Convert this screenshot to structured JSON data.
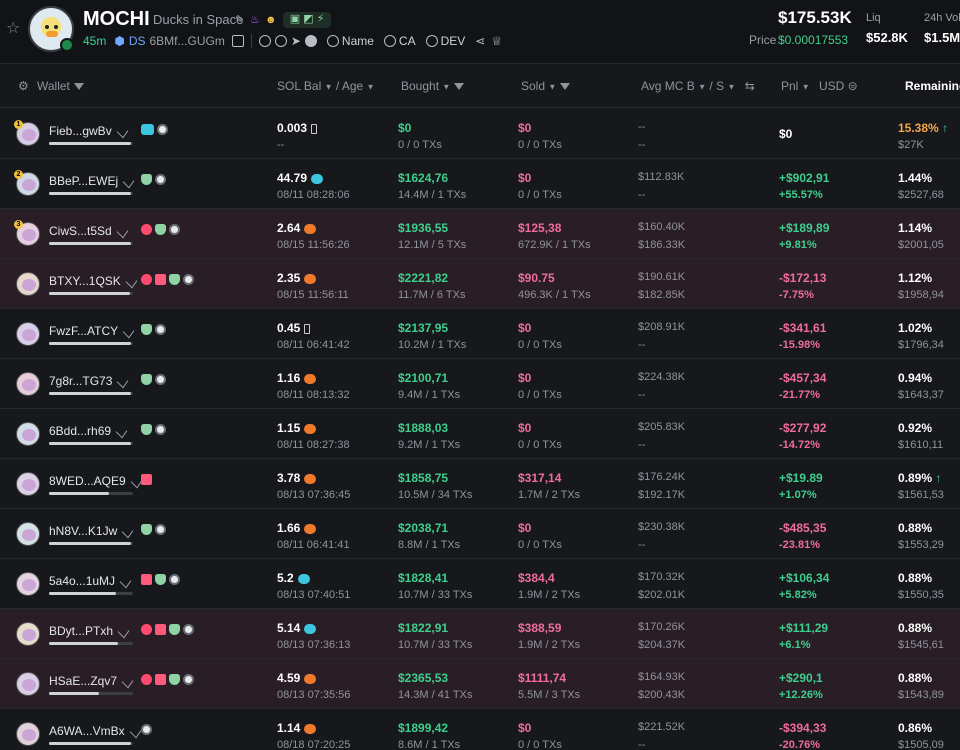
{
  "header": {
    "symbol": "MOCHI",
    "name": "Ducks in Space",
    "age": "45m",
    "ds_label": "DS",
    "address": "6BMf...GUGm",
    "search_name": "Name",
    "search_ca": "CA",
    "search_dev": "DEV",
    "price_usd": "$175.53K",
    "price_label": "Price",
    "price_value": "$0.00017553",
    "liq_label": "Liq",
    "liq_value": "$52.8K",
    "vol_label": "24h Vol",
    "vol_value": "$1.5M"
  },
  "columns": {
    "wallet": "Wallet",
    "sol_bal": "SOL Bal",
    "age": "Age",
    "bought": "Bought",
    "sold": "Sold",
    "avg_mc": "Avg MC B",
    "avg_mc_s": "S",
    "pnl": "Pnl",
    "usd": "USD",
    "remaining": "Remaining"
  },
  "rows": [
    {
      "wallet": "Fieb...gwBv",
      "rank": "1",
      "tags": [
        "fish",
        "disc"
      ],
      "bar": 0.98,
      "sol": "0.003",
      "sol_icon": "empty",
      "age": "--",
      "bought": "$0",
      "bought_sub": "0 / 0 TXs",
      "sold": "$0",
      "sold_sub": "0 / 0 TXs",
      "mcb": "--",
      "mcs": "--",
      "pnl": "$0",
      "pnl_pct": "",
      "pnl_color": "white",
      "pnl_pct_color": "green",
      "rem": "15.38%",
      "rem_sub": "$27K",
      "rem_color": "orange",
      "arrow": "↑",
      "hl": false
    },
    {
      "wallet": "BBeP...EWEj",
      "rank": "2",
      "tags": [
        "user",
        "disc"
      ],
      "bar": 0.98,
      "sol": "44.79",
      "sol_icon": "fish",
      "age": "08/11 08:28:06",
      "bought": "$1624,76",
      "bought_sub": "14.4M / 1 TXs",
      "sold": "$0",
      "sold_sub": "0 / 0 TXs",
      "mcb": "$112.83K",
      "mcs": "--",
      "pnl": "+$902,91",
      "pnl_pct": "+55.57%",
      "pnl_color": "green",
      "pnl_pct_color": "green",
      "rem": "1.44%",
      "rem_sub": "$2527,68",
      "rem_color": "white",
      "arrow": "",
      "hl": false
    },
    {
      "wallet": "CiwS...t5Sd",
      "rank": "3",
      "tags": [
        "warn",
        "user",
        "disc"
      ],
      "bar": 0.98,
      "sol": "2.64",
      "sol_icon": "sol",
      "age": "08/15 11:56:26",
      "bought": "$1936,55",
      "bought_sub": "12.1M / 5 TXs",
      "sold": "$125,38",
      "sold_sub": "672.9K / 1 TXs",
      "mcb": "$160.40K",
      "mcs": "$186.33K",
      "pnl": "+$189,89",
      "pnl_pct": "+9.81%",
      "pnl_color": "green",
      "pnl_pct_color": "green",
      "rem": "1.14%",
      "rem_sub": "$2001,05",
      "rem_color": "white",
      "arrow": "",
      "hl": true
    },
    {
      "wallet": "BTXY...1QSK",
      "rank": "",
      "tags": [
        "warn",
        "stack",
        "user",
        "disc"
      ],
      "bar": 0.96,
      "sol": "2.35",
      "sol_icon": "sol",
      "age": "08/15 11:56:11",
      "bought": "$2221,82",
      "bought_sub": "11.7M / 6 TXs",
      "sold": "$90.75",
      "sold_sub": "496.3K / 1 TXs",
      "mcb": "$190.61K",
      "mcs": "$182.85K",
      "pnl": "-$172,13",
      "pnl_pct": "-7.75%",
      "pnl_color": "pink",
      "pnl_pct_color": "pink",
      "rem": "1.12%",
      "rem_sub": "$1958,94",
      "rem_color": "white",
      "arrow": "",
      "hl": true
    },
    {
      "wallet": "FwzF...ATCY",
      "rank": "",
      "tags": [
        "user",
        "disc"
      ],
      "bar": 0.98,
      "sol": "0.45",
      "sol_icon": "empty",
      "age": "08/11 06:41:42",
      "bought": "$2137,95",
      "bought_sub": "10.2M / 1 TXs",
      "sold": "$0",
      "sold_sub": "0 / 0 TXs",
      "mcb": "$208.91K",
      "mcs": "--",
      "pnl": "-$341,61",
      "pnl_pct": "-15.98%",
      "pnl_color": "pink",
      "pnl_pct_color": "pink",
      "rem": "1.02%",
      "rem_sub": "$1796,34",
      "rem_color": "white",
      "arrow": "",
      "hl": false
    },
    {
      "wallet": "7g8r...TG73",
      "rank": "",
      "tags": [
        "user",
        "disc"
      ],
      "bar": 0.98,
      "sol": "1.16",
      "sol_icon": "sol",
      "age": "08/11 08:13:32",
      "bought": "$2100,71",
      "bought_sub": "9.4M / 1 TXs",
      "sold": "$0",
      "sold_sub": "0 / 0 TXs",
      "mcb": "$224.38K",
      "mcs": "--",
      "pnl": "-$457,34",
      "pnl_pct": "-21.77%",
      "pnl_color": "pink",
      "pnl_pct_color": "pink",
      "rem": "0.94%",
      "rem_sub": "$1643,37",
      "rem_color": "white",
      "arrow": "",
      "hl": false
    },
    {
      "wallet": "6Bdd...rh69",
      "rank": "",
      "tags": [
        "user",
        "disc"
      ],
      "bar": 0.98,
      "sol": "1.15",
      "sol_icon": "sol",
      "age": "08/11 08:27:38",
      "bought": "$1888,03",
      "bought_sub": "9.2M / 1 TXs",
      "sold": "$0",
      "sold_sub": "0 / 0 TXs",
      "mcb": "$205.83K",
      "mcs": "--",
      "pnl": "-$277,92",
      "pnl_pct": "-14.72%",
      "pnl_color": "pink",
      "pnl_pct_color": "pink",
      "rem": "0.92%",
      "rem_sub": "$1610,11",
      "rem_color": "white",
      "arrow": "",
      "hl": false
    },
    {
      "wallet": "8WED...AQE9",
      "rank": "",
      "tags": [
        "stack"
      ],
      "bar": 0.72,
      "sol": "3.78",
      "sol_icon": "sol",
      "age": "08/13 07:36:45",
      "bought": "$1858,75",
      "bought_sub": "10.5M / 34 TXs",
      "sold": "$317,14",
      "sold_sub": "1.7M / 2 TXs",
      "mcb": "$176.24K",
      "mcs": "$192.17K",
      "pnl": "+$19.89",
      "pnl_pct": "+1.07%",
      "pnl_color": "green",
      "pnl_pct_color": "green",
      "rem": "0.89%",
      "rem_sub": "$1561,53",
      "rem_color": "white",
      "arrow": "↑",
      "hl": false
    },
    {
      "wallet": "hN8V...K1Jw",
      "rank": "",
      "tags": [
        "user",
        "disc"
      ],
      "bar": 0.98,
      "sol": "1.66",
      "sol_icon": "sol",
      "age": "08/11 06:41:41",
      "bought": "$2038,71",
      "bought_sub": "8.8M / 1 TXs",
      "sold": "$0",
      "sold_sub": "0 / 0 TXs",
      "mcb": "$230.38K",
      "mcs": "--",
      "pnl": "-$485,35",
      "pnl_pct": "-23.81%",
      "pnl_color": "pink",
      "pnl_pct_color": "pink",
      "rem": "0.88%",
      "rem_sub": "$1553,29",
      "rem_color": "white",
      "arrow": "",
      "hl": false
    },
    {
      "wallet": "5a4o...1uMJ",
      "rank": "",
      "tags": [
        "stack",
        "user",
        "disc"
      ],
      "bar": 0.8,
      "sol": "5.2",
      "sol_icon": "fish",
      "age": "08/13 07:40:51",
      "bought": "$1828,41",
      "bought_sub": "10.7M / 33 TXs",
      "sold": "$384,4",
      "sold_sub": "1.9M / 2 TXs",
      "mcb": "$170.32K",
      "mcs": "$202.01K",
      "pnl": "+$106,34",
      "pnl_pct": "+5.82%",
      "pnl_color": "green",
      "pnl_pct_color": "green",
      "rem": "0.88%",
      "rem_sub": "$1550,35",
      "rem_color": "white",
      "arrow": "",
      "hl": false
    },
    {
      "wallet": "BDyt...PTxh",
      "rank": "",
      "tags": [
        "warn",
        "stack",
        "user",
        "disc"
      ],
      "bar": 0.82,
      "sol": "5.14",
      "sol_icon": "fish",
      "age": "08/13 07:36:13",
      "bought": "$1822,91",
      "bought_sub": "10.7M / 33 TXs",
      "sold": "$388,59",
      "sold_sub": "1.9M / 2 TXs",
      "mcb": "$170.26K",
      "mcs": "$204.37K",
      "pnl": "+$111,29",
      "pnl_pct": "+6.1%",
      "pnl_color": "green",
      "pnl_pct_color": "green",
      "rem": "0.88%",
      "rem_sub": "$1545,61",
      "rem_color": "white",
      "arrow": "",
      "hl": true
    },
    {
      "wallet": "HSaE...Zqv7",
      "rank": "",
      "tags": [
        "warn",
        "stack",
        "user",
        "disc"
      ],
      "bar": 0.6,
      "sol": "4.59",
      "sol_icon": "sol",
      "age": "08/13 07:35:56",
      "bought": "$2365,53",
      "bought_sub": "14.3M / 41 TXs",
      "sold": "$1111,74",
      "sold_sub": "5.5M / 3 TXs",
      "mcb": "$164.93K",
      "mcs": "$200.43K",
      "pnl": "+$290,1",
      "pnl_pct": "+12.26%",
      "pnl_color": "green",
      "pnl_pct_color": "green",
      "rem": "0.88%",
      "rem_sub": "$1543,89",
      "rem_color": "white",
      "arrow": "",
      "hl": true
    },
    {
      "wallet": "A6WA...VmBx",
      "rank": "",
      "tags": [
        "disc"
      ],
      "bar": 0.98,
      "sol": "1.14",
      "sol_icon": "sol",
      "age": "08/18 07:20:25",
      "bought": "$1899,42",
      "bought_sub": "8.6M / 1 TXs",
      "sold": "$0",
      "sold_sub": "0 / 0 TXs",
      "mcb": "$221.52K",
      "mcs": "--",
      "pnl": "-$394,33",
      "pnl_pct": "-20.76%",
      "pnl_color": "pink",
      "pnl_pct_color": "pink",
      "rem": "0.86%",
      "rem_sub": "$1505,09",
      "rem_color": "white",
      "arrow": "",
      "hl": false
    }
  ]
}
